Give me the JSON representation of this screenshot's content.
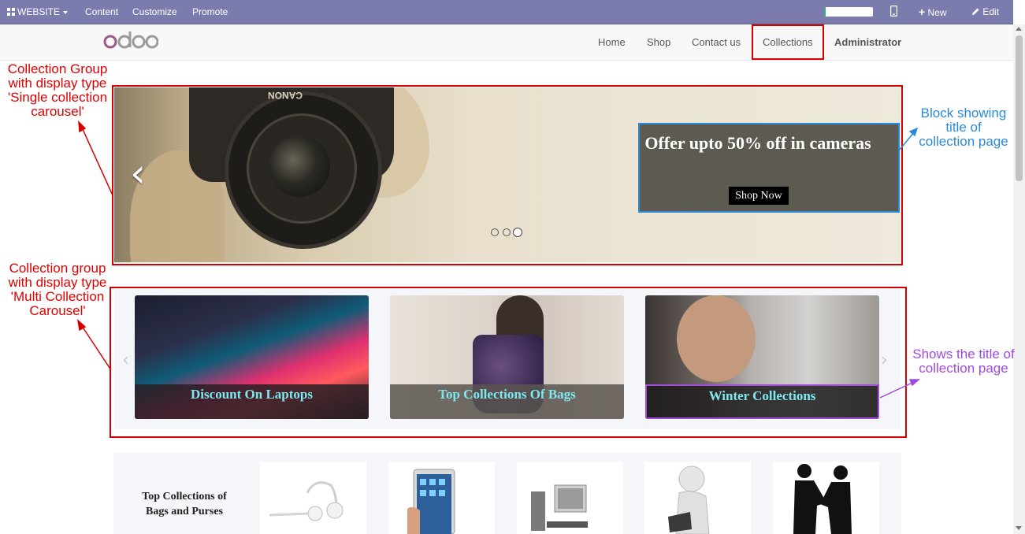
{
  "topbar": {
    "website_label": "WEBSITE",
    "content_label": "Content",
    "customize_label": "Customize",
    "promote_label": "Promote",
    "progress_percent": 3,
    "new_label": "New",
    "edit_label": "Edit",
    "icons": [
      "apps-grid-icon",
      "mobile-preview-icon",
      "plus-icon",
      "pencil-icon"
    ]
  },
  "navbar": {
    "logo_text": "odoo",
    "home": "Home",
    "shop": "Shop",
    "contact": "Contact us",
    "collections": "Collections",
    "user": "Administrator"
  },
  "hero": {
    "offer_title": "Offer upto 50% off in cameras",
    "shop_now": "Shop Now",
    "camera_brand": "CANON",
    "slides": 3,
    "active_slide": 3
  },
  "multi_carousel": {
    "cards": [
      {
        "caption": "Discount On Laptops"
      },
      {
        "caption": "Top Collections Of Bags"
      },
      {
        "caption": "Winter Collections"
      }
    ]
  },
  "bottom": {
    "title": "Top Collections of Bags and Purses",
    "items": [
      "earphones-image",
      "tablet-image",
      "desktop-computer-image",
      "figure-with-laptop-image",
      "handshake-image"
    ]
  },
  "annotations": {
    "single_carousel": "Collection Group with display type 'Single collection carousel'",
    "multi_carousel": "Collection group with display type 'Multi Collection Carousel'",
    "block_title": "Block showing title of collection page",
    "shows_title": "Shows the title of collection page"
  },
  "colors": {
    "topbar": "#7c7bad",
    "annotation_red": "#d40000",
    "annotation_blue": "#2b8ad8",
    "annotation_purple": "#a04ae0",
    "caption_text": "#7fe8f0"
  }
}
